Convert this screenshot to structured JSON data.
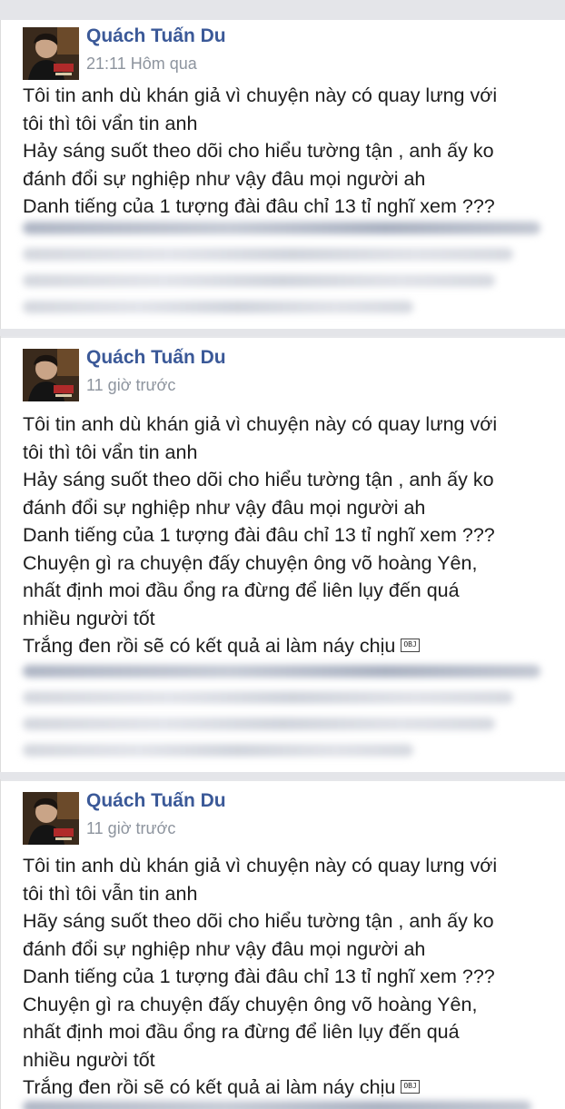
{
  "posts": [
    {
      "author": "Quách Tuấn Du",
      "time": "21:11 Hôm qua",
      "lines": [
        "Tôi tin anh dù khán giả vì chuyện này có quay lưng với",
        "tôi thì tôi vẩn tin anh",
        "Hảy sáng suốt theo dõi cho hiểu tường tận , anh ấy ko",
        "đánh đổi sự nghiệp như vậy đâu mọi người ah",
        "Danh tiếng của 1 tượng đài đâu chỉ 13 tỉ nghĩ xem ???"
      ],
      "obj_label": ""
    },
    {
      "author": "Quách Tuấn Du",
      "time": "11 giờ trước",
      "lines": [
        "Tôi tin anh dù khán giả vì chuyện này có quay lưng với",
        "tôi thì tôi vẩn tin anh",
        "Hảy sáng suốt theo dõi cho hiểu tường tận , anh ấy ko",
        "đánh đổi sự nghiệp như vậy đâu mọi người ah",
        "Danh tiếng của 1 tượng đài đâu chỉ 13 tỉ nghĩ xem ???",
        "Chuyện gì ra chuyện đấy chuyện ông võ hoàng Yên,",
        "nhất định moi đầu ổng ra đừng để liên lụy đến quá",
        "nhiều người tốt",
        "Trắng đen rồi sẽ có kết quả ai làm náy chịu"
      ],
      "obj_label": "OBJ"
    },
    {
      "author": "Quách Tuấn Du",
      "time": "11 giờ trước",
      "lines": [
        "Tôi tin anh dù khán giả vì chuyện này có quay lưng với",
        "tôi thì tôi vẫn tin anh",
        "Hãy sáng suốt theo dõi cho hiểu tường tận , anh ấy ko",
        "đánh đổi sự nghiệp như vậy đâu mọi người ah",
        "Danh tiếng của 1 tượng đài đâu chỉ 13 tỉ nghĩ xem ???",
        "Chuyện gì ra chuyện đấy chuyện ông võ hoàng Yên,",
        "nhất định moi đầu ổng ra đừng để liên lụy đến quá",
        "nhiều người tốt",
        "Trắng đen rồi sẽ có kết quả ai làm náy chịu"
      ],
      "obj_label": "OBJ"
    }
  ],
  "colors": {
    "author": "#3b5998",
    "timestamp": "#8d949e",
    "separator": "#e4e5e9"
  },
  "icons": [
    "avatar-photo",
    "obj-replacement-glyph"
  ]
}
